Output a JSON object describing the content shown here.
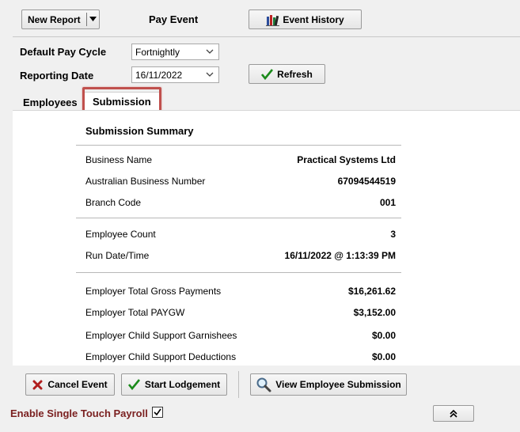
{
  "toolbar": {
    "new_report_label": "New Report",
    "pay_event_label": "Pay Event",
    "event_history_label": "Event History",
    "event_history_hotkey": "H"
  },
  "settings": {
    "pay_cycle_label": "Default Pay Cycle",
    "pay_cycle_value": "Fortnightly",
    "reporting_date_label": "Reporting Date",
    "reporting_date_value": "16/11/2022",
    "refresh_label": "Refresh"
  },
  "tabs": [
    {
      "label": "Employees",
      "selected": false
    },
    {
      "label": "Submission",
      "selected": true,
      "highlight_color": "#c0504d"
    }
  ],
  "summary": {
    "title": "Submission Summary",
    "business_name_label": "Business Name",
    "business_name_value": "Practical Systems Ltd",
    "abn_label": "Australian Business Number",
    "abn_value": "67094544519",
    "branch_label": "Branch Code",
    "branch_value": "001",
    "employee_count_label": "Employee Count",
    "employee_count_value": "3",
    "run_datetime_label": "Run Date/Time",
    "run_datetime_value": "16/11/2022 @ 1:13:39 PM",
    "gross_label": "Employer Total Gross Payments",
    "gross_value": "$16,261.62",
    "paygw_label": "Employer Total PAYGW",
    "paygw_value": "$3,152.00",
    "garnishees_label": "Employer Child Support Garnishees",
    "garnishees_value": "$0.00",
    "deductions_label": "Employer Child Support Deductions",
    "deductions_value": "$0.00"
  },
  "footer": {
    "cancel_label": "Cancel Event",
    "start_lodgement_label": "Start Lodgement",
    "view_employee_label": "View Employee Submission",
    "stp_label": "Enable Single Touch Payroll",
    "stp_checked": true,
    "stp_color": "#7a1f1f"
  }
}
